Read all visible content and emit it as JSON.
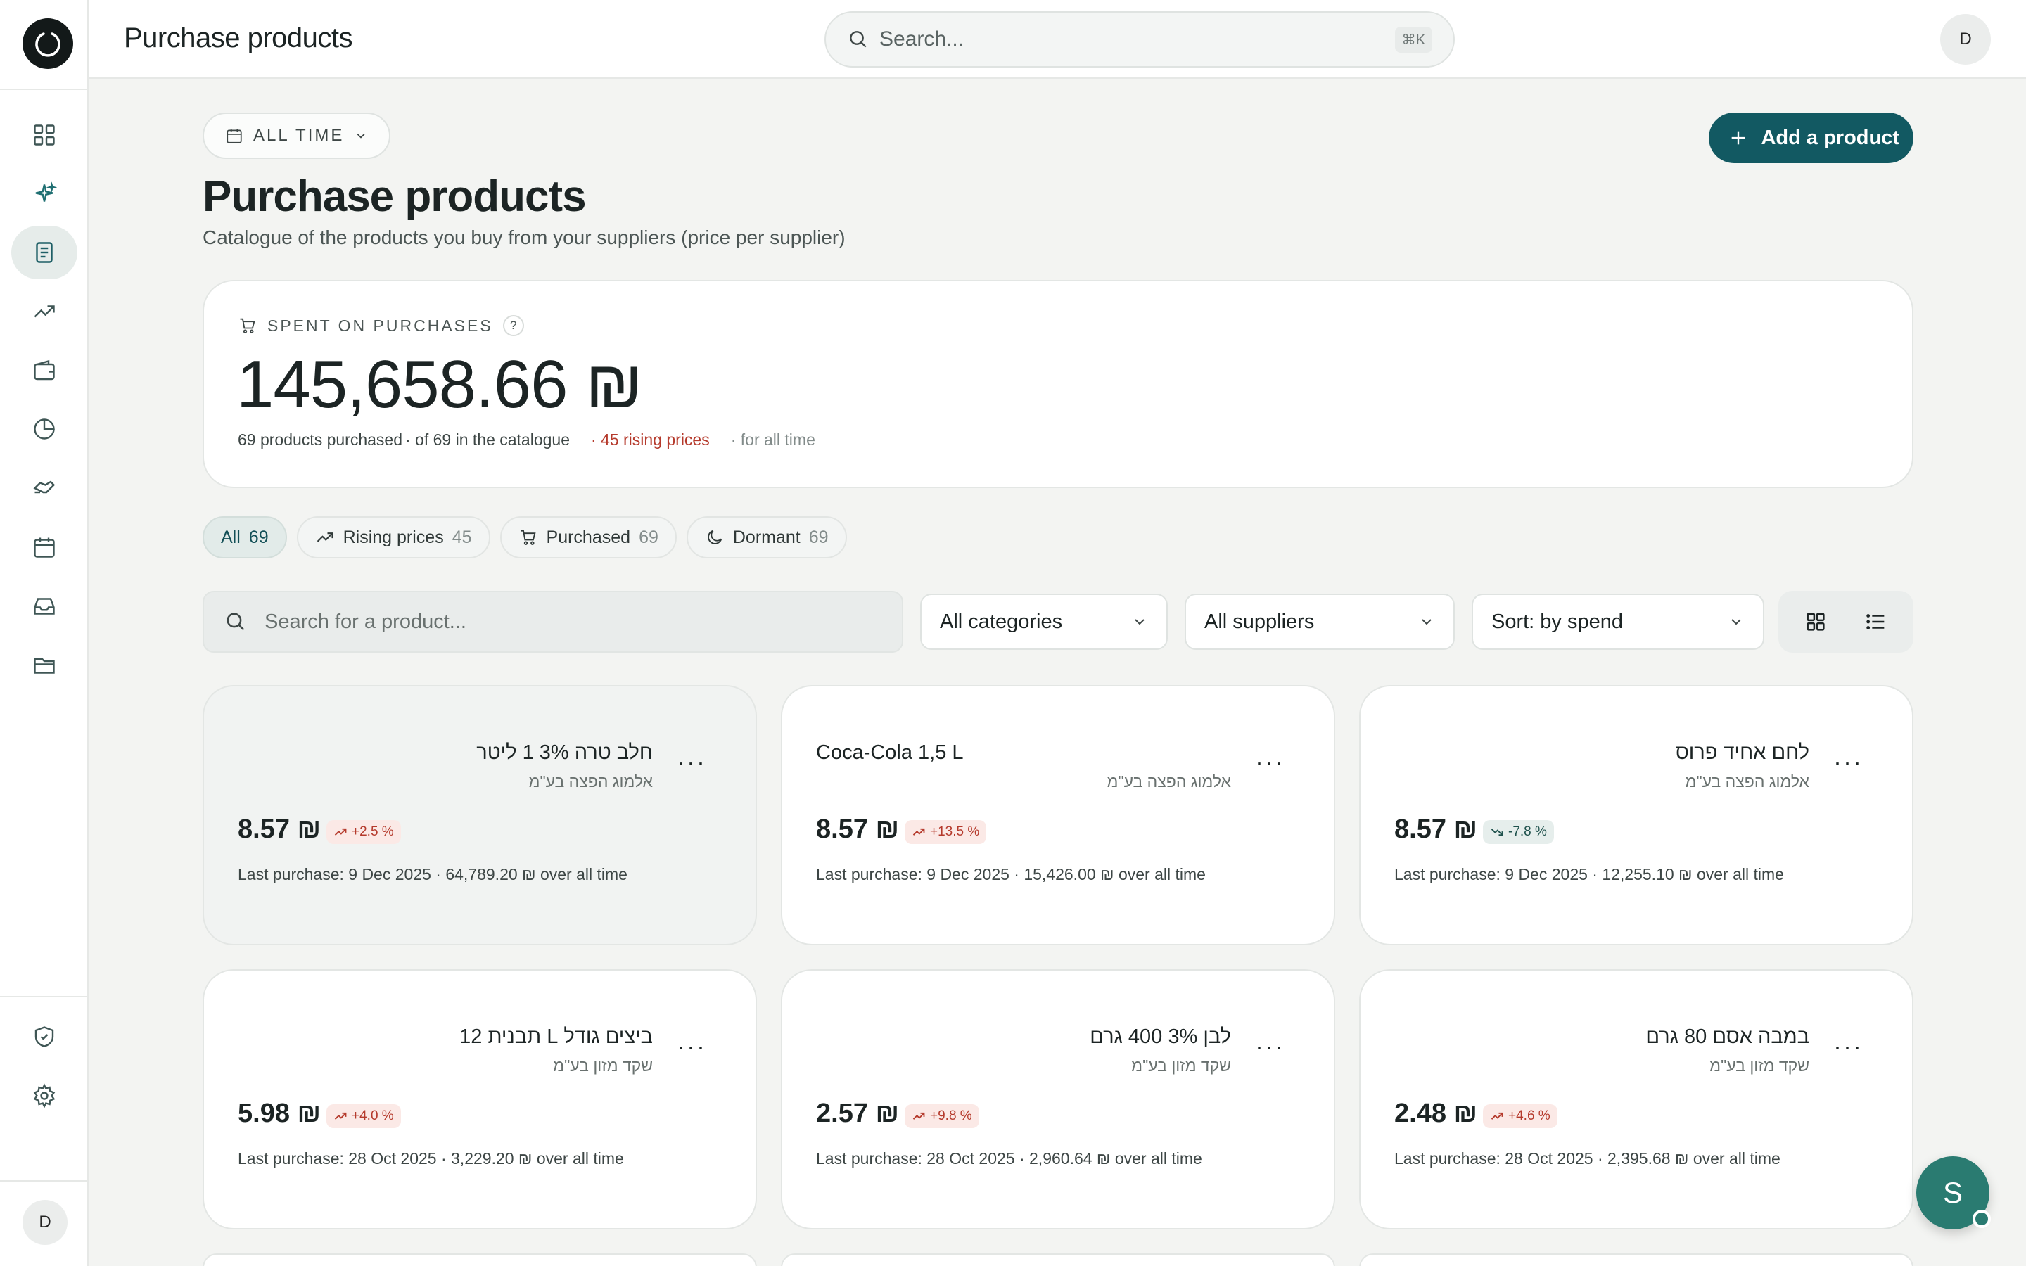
{
  "topbar": {
    "title": "Purchase products",
    "search_placeholder": "Search...",
    "search_shortcut": "⌘K",
    "avatar_initial": "D"
  },
  "sidebar": {
    "avatar_initial": "D",
    "items": [
      {
        "icon": "dashboard-icon"
      },
      {
        "icon": "sparkles-icon"
      },
      {
        "icon": "document-icon",
        "active": true
      },
      {
        "icon": "trending-up-icon"
      },
      {
        "icon": "wallet-icon"
      },
      {
        "icon": "pie-chart-icon"
      },
      {
        "icon": "handshake-icon"
      },
      {
        "icon": "calendar-icon"
      },
      {
        "icon": "inbox-icon"
      },
      {
        "icon": "folder-icon"
      },
      {
        "icon": "shield-check-icon"
      },
      {
        "icon": "gear-icon"
      }
    ]
  },
  "header": {
    "period_label": "ALL TIME",
    "add_button_label": "Add a product",
    "title": "Purchase products",
    "subtitle": "Catalogue of the products you buy from your suppliers (price per supplier)"
  },
  "spent": {
    "label": "SPENT ON PURCHASES",
    "help": "?",
    "amount": "145,658.66 ₪",
    "products_purchased": "69 products purchased",
    "catalogue": "· of 69 in the catalogue",
    "rising": "· 45 rising prices",
    "period": "· for all time"
  },
  "tabs": [
    {
      "label": "All",
      "count": "69"
    },
    {
      "label": "Rising prices",
      "count": "45"
    },
    {
      "label": "Purchased",
      "count": "69"
    },
    {
      "label": "Dormant",
      "count": "69"
    }
  ],
  "filters": {
    "search_placeholder": "Search for a product...",
    "category": "All categories",
    "supplier": "All suppliers",
    "sort": "Sort: by spend"
  },
  "products": [
    {
      "name": "חלב טרה 3% 1 ליטר",
      "supplier": "אלמוג הפצה בע\"מ",
      "price": "8.57 ₪",
      "change": "+2.5 %",
      "direction": "up",
      "last": "Last purchase: 9 Dec 2025 · 64,789.20 ₪ over all time"
    },
    {
      "name": "Coca-Cola 1,5 L",
      "supplier": "אלמוג הפצה בע\"מ",
      "price": "8.57 ₪",
      "change": "+13.5 %",
      "direction": "up",
      "last": "Last purchase: 9 Dec 2025 · 15,426.00 ₪ over all time"
    },
    {
      "name": "לחם אחיד פרוס",
      "supplier": "אלמוג הפצה בע\"מ",
      "price": "8.57 ₪",
      "change": "-7.8 %",
      "direction": "down",
      "last": "Last purchase: 9 Dec 2025 · 12,255.10 ₪ over all time"
    },
    {
      "name": "ביצים גודל L תבנית 12",
      "supplier": "שקד מזון בע\"מ",
      "price": "5.98 ₪",
      "change": "+4.0 %",
      "direction": "up",
      "last": "Last purchase: 28 Oct 2025 · 3,229.20 ₪ over all time"
    },
    {
      "name": "לבן 3% 400 גרם",
      "supplier": "שקד מזון בע\"מ",
      "price": "2.57 ₪",
      "change": "+9.8 %",
      "direction": "up",
      "last": "Last purchase: 28 Oct 2025 · 2,960.64 ₪ over all time"
    },
    {
      "name": "במבה אסם 80 גרם",
      "supplier": "שקד מזון בע\"מ",
      "price": "2.48 ₪",
      "change": "+4.6 %",
      "direction": "up",
      "last": "Last purchase: 28 Oct 2025 · 2,395.68 ₪ over all time"
    }
  ],
  "fab": {
    "initial": "S"
  },
  "colors": {
    "accent": "#125962",
    "rising": "#b53a2c",
    "fab": "#2a7b71"
  }
}
